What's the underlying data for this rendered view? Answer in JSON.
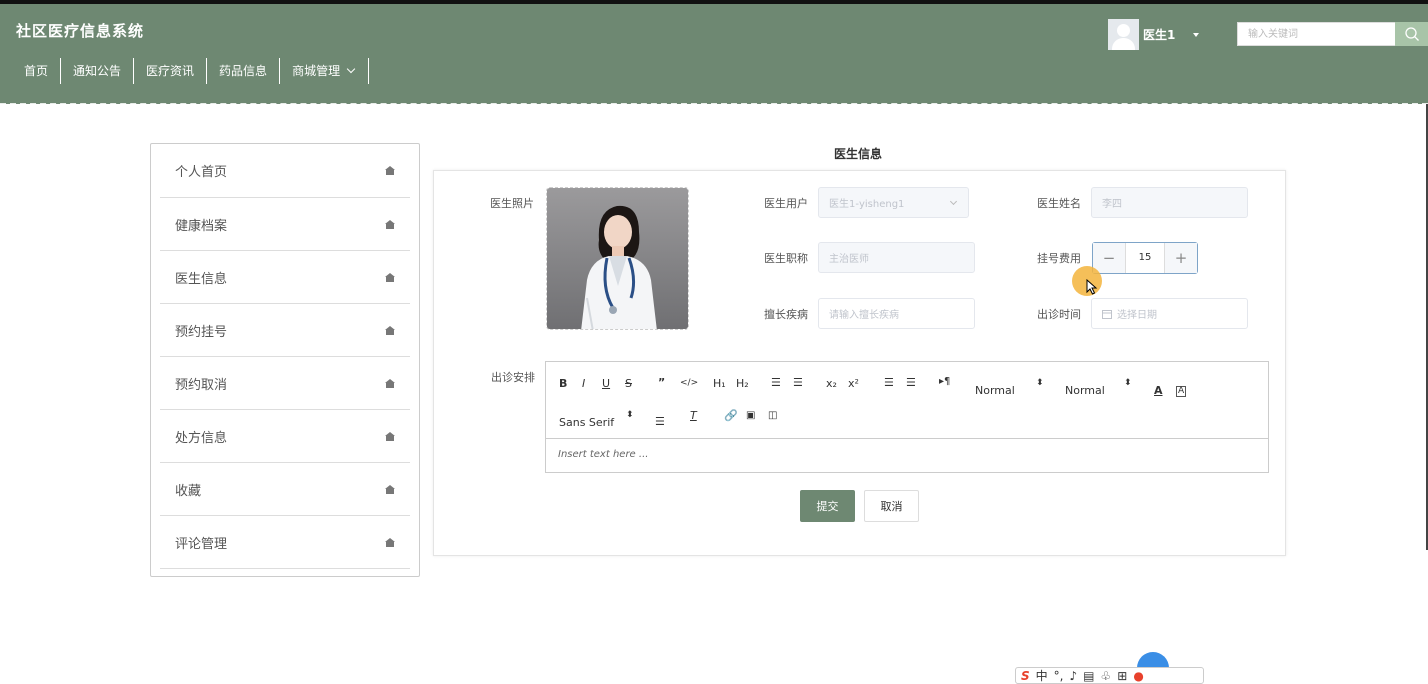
{
  "app": {
    "title": "社区医疗信息系统"
  },
  "nav": {
    "items": [
      "首页",
      "通知公告",
      "医疗资讯",
      "药品信息",
      "商城管理"
    ]
  },
  "user": {
    "name": "医生1"
  },
  "search": {
    "placeholder": "输入关键词"
  },
  "sidebar": {
    "items": [
      "个人首页",
      "健康档案",
      "医生信息",
      "预约挂号",
      "预约取消",
      "处方信息",
      "收藏",
      "评论管理"
    ]
  },
  "form": {
    "title": "医生信息",
    "photo_label": "医生照片",
    "account_label": "医生用户",
    "account_value": "医生1-yisheng1",
    "name_label": "医生姓名",
    "name_value": "李四",
    "title_label": "医生职称",
    "title_value": "主治医师",
    "fee_label": "挂号费用",
    "fee_value": "15",
    "specialty_label": "擅长疾病",
    "specialty_placeholder": "请输入擅长疾病",
    "time_label": "出诊时间",
    "time_placeholder": "选择日期",
    "schedule_label": "出诊安排",
    "editor": {
      "header_select": "Normal",
      "size_select": "Normal",
      "font_select": "Sans Serif",
      "placeholder": "Insert text here ..."
    },
    "submit_label": "提交",
    "cancel_label": "取消"
  },
  "ime": {
    "lang": "中"
  },
  "colors": {
    "header": "#6e8872",
    "accent": "#6e8872",
    "search_btn": "#a8c4a8",
    "stepper_border": "#7ea4c8"
  }
}
